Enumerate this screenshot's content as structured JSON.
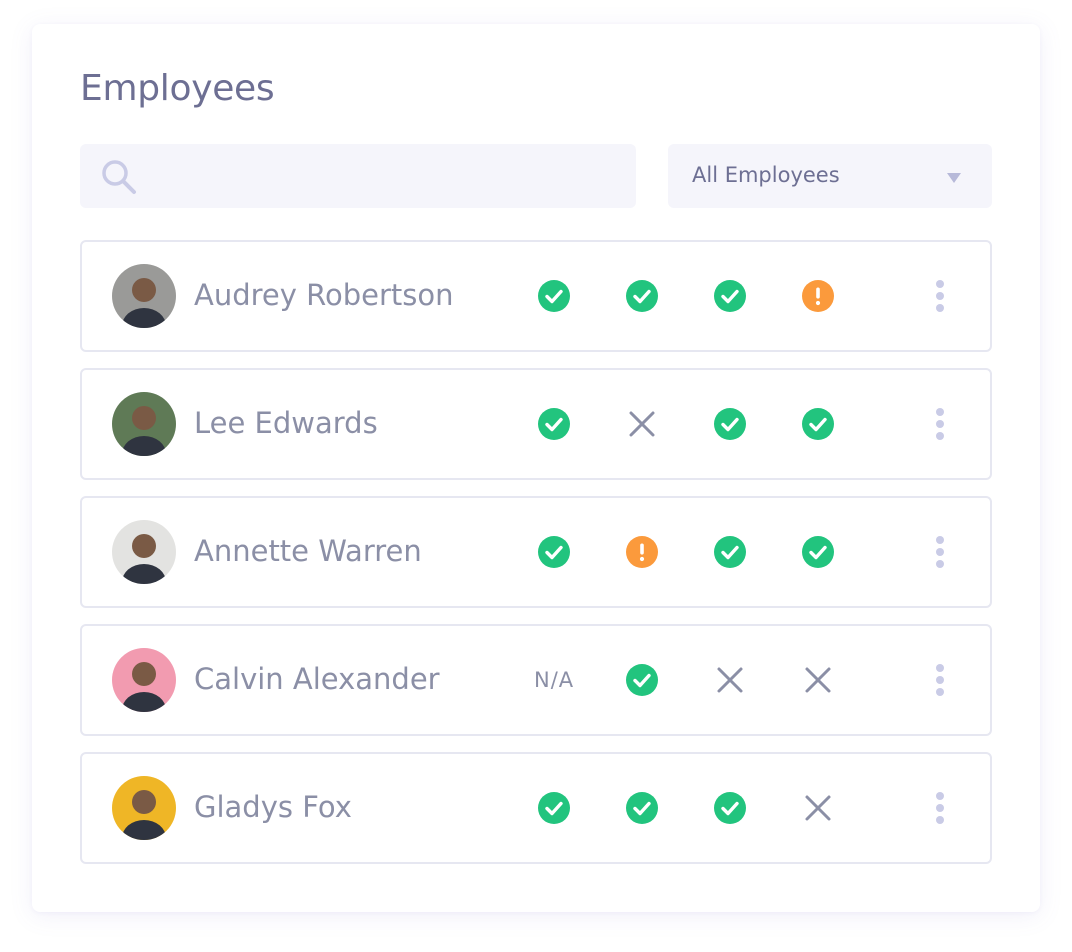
{
  "header": {
    "title": "Employees"
  },
  "search": {
    "placeholder": "",
    "value": ""
  },
  "filter": {
    "selected": "All Employees"
  },
  "colors": {
    "check": "#22c47e",
    "warning": "#fb9a3c",
    "cross": "#8b8fa6",
    "title": "#6d6f93"
  },
  "employees": [
    {
      "name": "Audrey Robertson",
      "avatar_bg": "#9a9a98",
      "statuses": [
        "check",
        "check",
        "check",
        "warning"
      ]
    },
    {
      "name": "Lee Edwards",
      "avatar_bg": "#5f7a56",
      "statuses": [
        "check",
        "cross",
        "check",
        "check"
      ]
    },
    {
      "name": "Annette Warren",
      "avatar_bg": "#e3e3e1",
      "statuses": [
        "check",
        "warning",
        "check",
        "check"
      ]
    },
    {
      "name": "Calvin Alexander",
      "avatar_bg": "#f29bb0",
      "statuses": [
        "na",
        "check",
        "cross",
        "cross"
      ]
    },
    {
      "name": "Gladys Fox",
      "avatar_bg": "#efb626",
      "statuses": [
        "check",
        "check",
        "check",
        "cross"
      ]
    }
  ],
  "labels": {
    "na": "N/A"
  }
}
